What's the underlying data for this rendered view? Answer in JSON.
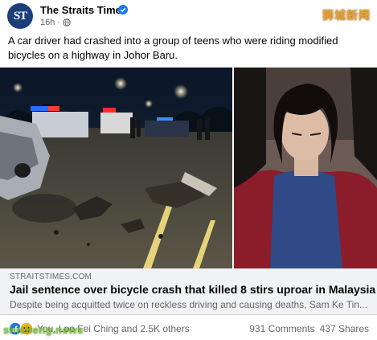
{
  "post": {
    "page_name": "The Straits Times",
    "avatar_text": "ST",
    "time": "16h",
    "separator": "·",
    "caption": "A car driver had crashed into a group of teens who were riding modified bicycles on a highway in Johor Baru."
  },
  "watermark": {
    "top": "狮城新闻",
    "bottom": "shicheng.news"
  },
  "link_preview": {
    "domain": "STRAITSTIMES.COM",
    "title": "Jail sentence over bicycle crash that killed 8 stirs uproar in Malaysia",
    "description": "Despite being acquitted twice on reckless driving and causing deaths, Sam Ke Tin..."
  },
  "footer": {
    "reactions_text": "You, Loo Fei Ching and 2.5K others",
    "comments": "931 Comments",
    "shares": "437 Shares"
  },
  "colors": {
    "brand": "#1c3f7a",
    "verified": "#1877f2",
    "like": "#1877f2",
    "sad": "#f7b125"
  },
  "icons": [
    "verified-icon",
    "globe-icon",
    "like-reaction-icon",
    "sad-reaction-icon"
  ]
}
